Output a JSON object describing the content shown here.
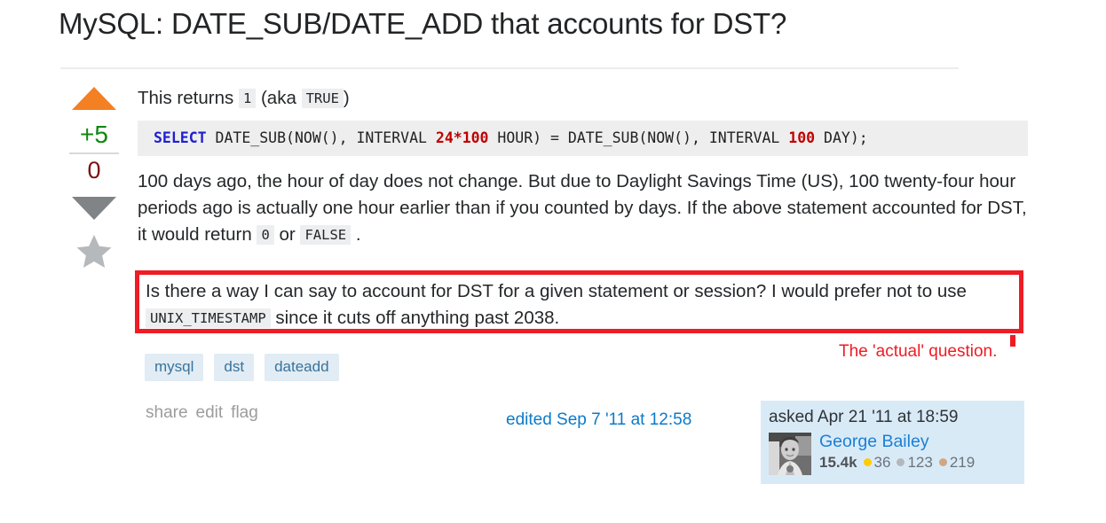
{
  "question": {
    "title": "MySQL: DATE_SUB/DATE_ADD that accounts for DST?",
    "intro": {
      "before": "This returns",
      "code1": "1",
      "middle": "(aka",
      "code2": "TRUE",
      "after": ")"
    },
    "code_block": {
      "keyword": "SELECT",
      "rest_1": " DATE_SUB(NOW(), INTERVAL ",
      "num_1": "24*100",
      "rest_2": " HOUR) = DATE_SUB(NOW(), INTERVAL ",
      "num_2": "100",
      "rest_3": " DAY);"
    },
    "body": {
      "part_1": "100 days ago, the hour of day does not change. But due to Daylight Savings Time (US), 100 twenty-four hour periods ago is actually one hour earlier than if you counted by days. If the above statement accounted for DST, it would return",
      "code_0": "0",
      "part_2": "or",
      "code_false": "FALSE",
      "part_3": "."
    },
    "highlight": {
      "part_1": "Is there a way I can say to account for DST for a given statement or session? I would prefer not to use",
      "code": "UNIX_TIMESTAMP",
      "part_2": "since it cuts off anything past 2038."
    },
    "annotation": "The 'actual' question."
  },
  "votes": {
    "score": "+5",
    "favorites": "0",
    "upvote_icon": "triangle-up-icon",
    "downvote_icon": "triangle-down-icon",
    "favorite_icon": "star-icon"
  },
  "tags": [
    "mysql",
    "dst",
    "dateadd"
  ],
  "actions": [
    "share",
    "edit",
    "flag"
  ],
  "edited": "edited Sep 7 '11 at 12:58",
  "owner": {
    "asked": "asked Apr 21 '11 at 18:59",
    "name": "George Bailey",
    "reputation": "15.4k",
    "gold": "36",
    "silver": "123",
    "bronze": "219"
  },
  "colors": {
    "accent_orange": "#f48024",
    "score_green": "#108710",
    "fav_red": "#7a1212",
    "link_blue": "#0c7ac9",
    "highlight_red": "#ee1c25",
    "tag_bg": "#e1ecf4",
    "tag_fg": "#39739d",
    "card_bg": "#d9eaf7",
    "code_bg": "#eeeeee"
  }
}
